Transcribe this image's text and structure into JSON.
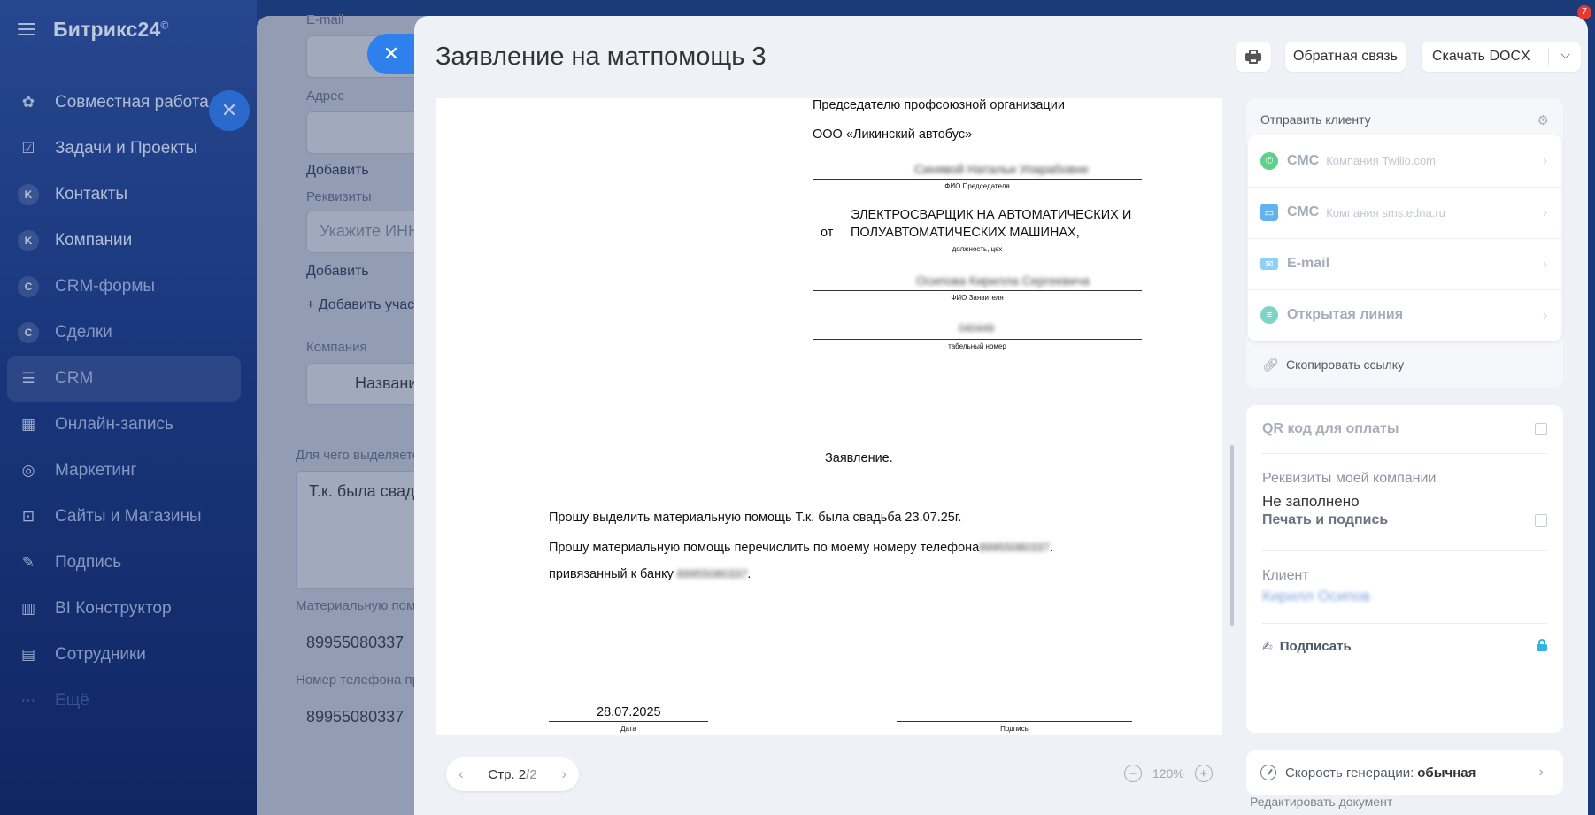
{
  "sidebar": {
    "brand": "Битрикс24",
    "brand_mark": "©",
    "items": [
      {
        "label": "Совместная работа",
        "icon": "chat-icon"
      },
      {
        "label": "Задачи и Проекты",
        "icon": "checkbox-icon"
      },
      {
        "label": "Контакты",
        "icon": "letter-k-icon",
        "badge": "K"
      },
      {
        "label": "Компании",
        "icon": "letter-k-icon",
        "badge": "K"
      },
      {
        "label": "CRM-формы",
        "icon": "letter-c-icon",
        "badge": "C"
      },
      {
        "label": "Сделки",
        "icon": "letter-c-icon",
        "badge": "C"
      },
      {
        "label": "CRM",
        "icon": "funnel-icon"
      },
      {
        "label": "Онлайн-запись",
        "icon": "calendar-icon"
      },
      {
        "label": "Маркетинг",
        "icon": "target-icon"
      },
      {
        "label": "Сайты и Магазины",
        "icon": "cart-icon"
      },
      {
        "label": "Подпись",
        "icon": "pen-icon"
      },
      {
        "label": "BI Конструктор",
        "icon": "bar-chart-icon"
      },
      {
        "label": "Сотрудники",
        "icon": "id-card-icon"
      },
      {
        "label": "Ещё",
        "icon": "more-icon"
      }
    ]
  },
  "bg_form": {
    "email_label": "E-mail",
    "address_label": "Адрес",
    "add_1": "Добавить",
    "requisites_label": "Реквизиты",
    "inn_placeholder": "Укажите ИНН",
    "add_2": "Добавить",
    "add_participant": "+ Добавить учас",
    "company_label": "Компания",
    "company_placeholder": "Названи",
    "purpose_label": "Для чего выделяется",
    "purpose_value": "Т.к. была свадь",
    "matpom_label": "Материальную пом",
    "phone_1": "89955080337",
    "card_label": "Номер телефона пр",
    "phone_2": "89955080337"
  },
  "header": {
    "title": "Заявление на матпомощь 3",
    "feedback": "Обратная связь",
    "download": "Скачать DOCX"
  },
  "document": {
    "to_line1": "Председателю профсоюзной организации",
    "to_line2": "ООО «Ликинский автобус»",
    "chair_name": "Синявой Натальи Упарабовне",
    "cap_chair": "ФИО Председателя",
    "from": "от",
    "position_line1": "ЭЛЕКТРОСВАРЩИК НА АВТОМАТИЧЕСКИХ И",
    "position_line2": "ПОЛУАВТОМАТИЧЕСКИХ МАШИНАХ,",
    "cap_position": "должность, цех",
    "applicant_name": "Осипова Кирилла Сергеевича",
    "cap_applicant": "ФИО Заявителя",
    "tab_number": "040449",
    "cap_tab": "табельный номер",
    "heading": "Заявление.",
    "para1": "Прошу выделить материальную помощь Т.к. была свадьба 23.07.25г.",
    "para2": "Прошу материальную помощь перечислить по моему номеру телефона",
    "para2_phone": "89955080337",
    "para2_end": ".",
    "para3": "привязанный к банку",
    "para3_bank": "89955080337",
    "para3_end": ".",
    "date": "28.07.2025",
    "cap_date": "Дата",
    "cap_sign": "Подпись"
  },
  "pager": {
    "prefix": "Стр. 2",
    "total": "/2"
  },
  "zoom": {
    "value": "120%"
  },
  "send": {
    "title": "Отправить клиенту",
    "channels": [
      {
        "name": "СМС",
        "sub": "Компания Twilio.com",
        "icon": "whatsapp-icon",
        "color": "#5ed08a"
      },
      {
        "name": "СМС",
        "sub": "Компания sms.edna.ru",
        "icon": "chat-bubble-icon",
        "color": "#63b2f0"
      },
      {
        "name": "E-mail",
        "sub": "",
        "icon": "envelope-icon",
        "color": "#8dd2f2"
      },
      {
        "name": "Открытая линия",
        "sub": "",
        "icon": "open-line-icon",
        "color": "#7fd3c9"
      }
    ],
    "copy_link": "Скопировать ссылку"
  },
  "requisites": {
    "qr": "QR код для оплаты",
    "my_company": "Реквизиты моей компании",
    "not_filled": "Не заполнено",
    "stamp": "Печать и подпись",
    "client_label": "Клиент",
    "client_name": "Кирилл Осипов",
    "sign": "Подписать"
  },
  "speed": {
    "label": "Скорость генерации:",
    "value": "обычная"
  },
  "edit_doc": "Редактировать документ",
  "notification_count": "7"
}
